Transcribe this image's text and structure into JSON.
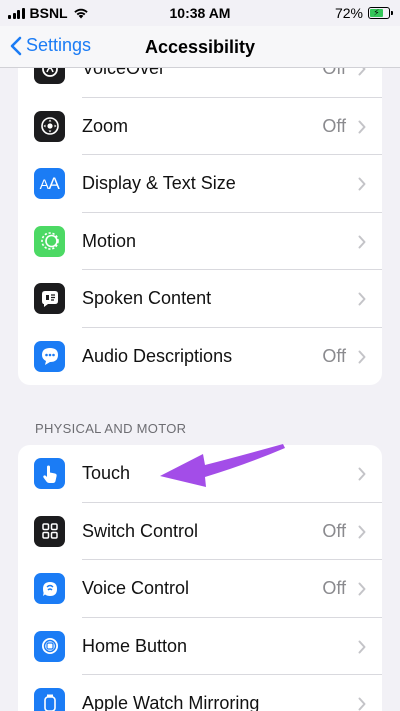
{
  "status": {
    "carrier": "BSNL",
    "time": "10:38 AM",
    "battery": "72%",
    "battery_level": 0.72
  },
  "nav": {
    "back_label": "Settings",
    "title": "Accessibility"
  },
  "vision": {
    "items": [
      {
        "label": "VoiceOver",
        "value": "Off",
        "icon": "voiceover-icon",
        "color": "#1c1c1e"
      },
      {
        "label": "Zoom",
        "value": "Off",
        "icon": "zoom-icon",
        "color": "#1c1c1e"
      },
      {
        "label": "Display & Text Size",
        "value": "",
        "icon": "text-size-icon",
        "color": "#1b7cf5"
      },
      {
        "label": "Motion",
        "value": "",
        "icon": "motion-icon",
        "color": "#4cd964"
      },
      {
        "label": "Spoken Content",
        "value": "",
        "icon": "spoken-content-icon",
        "color": "#1c1c1e"
      },
      {
        "label": "Audio Descriptions",
        "value": "Off",
        "icon": "audio-descriptions-icon",
        "color": "#1b7cf5"
      }
    ]
  },
  "physical_motor": {
    "header": "PHYSICAL AND MOTOR",
    "items": [
      {
        "label": "Touch",
        "value": "",
        "icon": "touch-icon",
        "color": "#1b7cf5"
      },
      {
        "label": "Switch Control",
        "value": "Off",
        "icon": "switch-control-icon",
        "color": "#1c1c1e"
      },
      {
        "label": "Voice Control",
        "value": "Off",
        "icon": "voice-control-icon",
        "color": "#1b7cf5"
      },
      {
        "label": "Home Button",
        "value": "",
        "icon": "home-button-icon",
        "color": "#1b7cf5"
      },
      {
        "label": "Apple Watch Mirroring",
        "value": "",
        "icon": "apple-watch-icon",
        "color": "#1b7cf5"
      }
    ]
  },
  "annotation": {
    "color": "#a34de8",
    "icon": "pointer-arrow-icon"
  }
}
